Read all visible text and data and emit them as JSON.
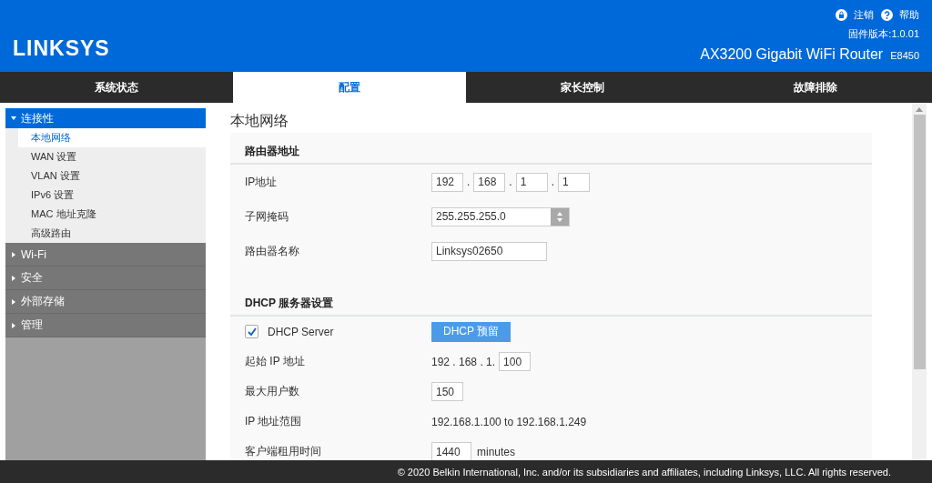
{
  "header": {
    "logo": "LINKSYS",
    "links": [
      {
        "kind": "lock",
        "label": "注销"
      },
      {
        "kind": "help",
        "label": "帮助"
      }
    ],
    "firmware": "固件版本:1.0.01",
    "model": "AX3200 Gigabit WiFi Router",
    "model_code": "E8450"
  },
  "tabs": [
    {
      "label": "系统状态",
      "selected": false
    },
    {
      "label": "配置",
      "selected": true
    },
    {
      "label": "家长控制",
      "selected": false
    },
    {
      "label": "故障排除",
      "selected": false
    }
  ],
  "sidebar": [
    {
      "label": "连接性",
      "expanded": true,
      "children": [
        {
          "label": "本地网络",
          "selected": true
        },
        {
          "label": "WAN 设置",
          "selected": false
        },
        {
          "label": "VLAN 设置",
          "selected": false
        },
        {
          "label": "IPv6 设置",
          "selected": false
        },
        {
          "label": "MAC 地址克隆",
          "selected": false
        },
        {
          "label": "高级路由",
          "selected": false
        }
      ]
    },
    {
      "label": "Wi-Fi",
      "expanded": false
    },
    {
      "label": "安全",
      "expanded": false
    },
    {
      "label": "外部存储",
      "expanded": false
    },
    {
      "label": "管理",
      "expanded": false
    }
  ],
  "page_title": "本地网络",
  "sections": [
    {
      "heading": "路由器地址",
      "rows": [
        {
          "kind": "ip",
          "label": "IP地址",
          "octets": [
            "192",
            "168",
            "1",
            "1"
          ],
          "separator": "."
        },
        {
          "kind": "select",
          "label": "子网掩码",
          "value": "255.255.255.0"
        },
        {
          "kind": "input",
          "label": "路由器名称",
          "value": "Linksys02650",
          "wide": true
        }
      ]
    },
    {
      "heading": "DHCP 服务器设置",
      "rows": [
        {
          "kind": "checkbox",
          "label": "DHCP Server",
          "checked": true,
          "button": "DHCP 预留"
        },
        {
          "kind": "prefix",
          "label": "起始 IP 地址",
          "prefix": "192 . 168 . 1.",
          "value": "100"
        },
        {
          "kind": "input",
          "label": "最大用户数",
          "value": "150",
          "wide": false
        },
        {
          "kind": "text",
          "label": "IP 地址范围",
          "value": "192.168.1.100 to 192.168.1.249"
        },
        {
          "kind": "suffix",
          "label": "客户端租用时间",
          "value": "1440",
          "suffix": "minutes"
        }
      ]
    }
  ],
  "footer": "© 2020 Belkin International, Inc. and/or its subsidiaries and affiliates, including Linksys, LLC. All rights reserved."
}
